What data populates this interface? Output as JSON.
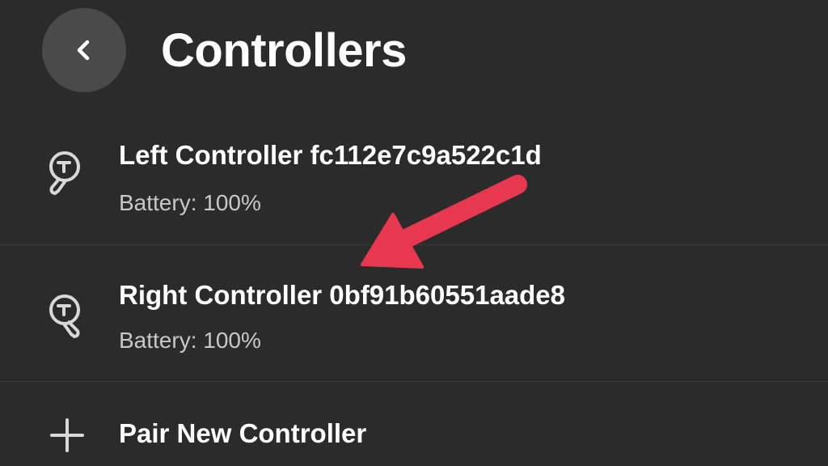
{
  "header": {
    "back_icon": "chevron-left-icon",
    "title": "Controllers"
  },
  "controllers": [
    {
      "icon": "controller-icon",
      "name": "Left Controller fc112e7c9a522c1d",
      "battery": "Battery: 100%"
    },
    {
      "icon": "controller-icon",
      "name": "Right Controller 0bf91b60551aade8",
      "battery": "Battery: 100%"
    }
  ],
  "pair": {
    "icon": "plus-icon",
    "label": "Pair New Controller"
  },
  "annotation": {
    "arrow_color": "#e8384f"
  },
  "colors": {
    "background": "#2b2b2b",
    "back_button": "#4a4a4a",
    "text_primary": "#ffffff",
    "text_secondary": "#c8c8c8"
  }
}
